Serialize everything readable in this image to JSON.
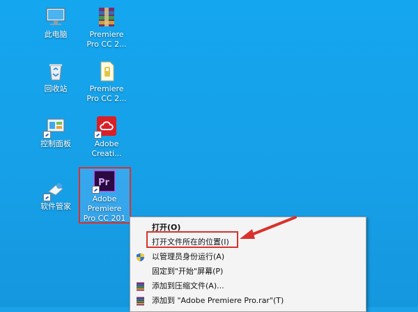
{
  "desktop": {
    "icons": [
      {
        "label": "此电脑",
        "icon": "computer-icon"
      },
      {
        "label": "Premiere\nPro CC 2...",
        "icon": "winrar-archive-icon"
      },
      {
        "label": "回收站",
        "icon": "recycle-bin-icon"
      },
      {
        "label": "Premiere\nPro CC 2...",
        "icon": "text-file-icon"
      },
      {
        "label": "控制面板",
        "icon": "control-panel-icon"
      },
      {
        "label": "Adobe\nCreati...",
        "icon": "adobe-creative-cloud-icon"
      },
      {
        "label": "软件管家",
        "icon": "software-manager-icon"
      },
      {
        "label": "Adobe\nPremiere\nPro CC 201",
        "icon": "premiere-pro-icon"
      }
    ],
    "colors": {
      "background": "#16a0e8",
      "highlight_red": "#d9312c",
      "premiere_purple": "#2a0a40",
      "premiere_text": "#d7a3ff",
      "adobe_red": "#da1f26"
    }
  },
  "context_menu": {
    "items": [
      {
        "label": "打开(O)",
        "bold": true
      },
      {
        "label": "打开文件所在的位置(I)"
      },
      {
        "label": "以管理员身份运行(A)",
        "icon": "uac-shield-icon"
      },
      {
        "label": "固定到\"开始\"屏幕(P)"
      },
      {
        "label": "添加到压缩文件(A)...",
        "icon": "winrar-icon"
      },
      {
        "label": "添加到 \"Adobe Premiere Pro.rar\"(T)",
        "icon": "winrar-icon"
      }
    ]
  },
  "premiere_badge": "Pr"
}
